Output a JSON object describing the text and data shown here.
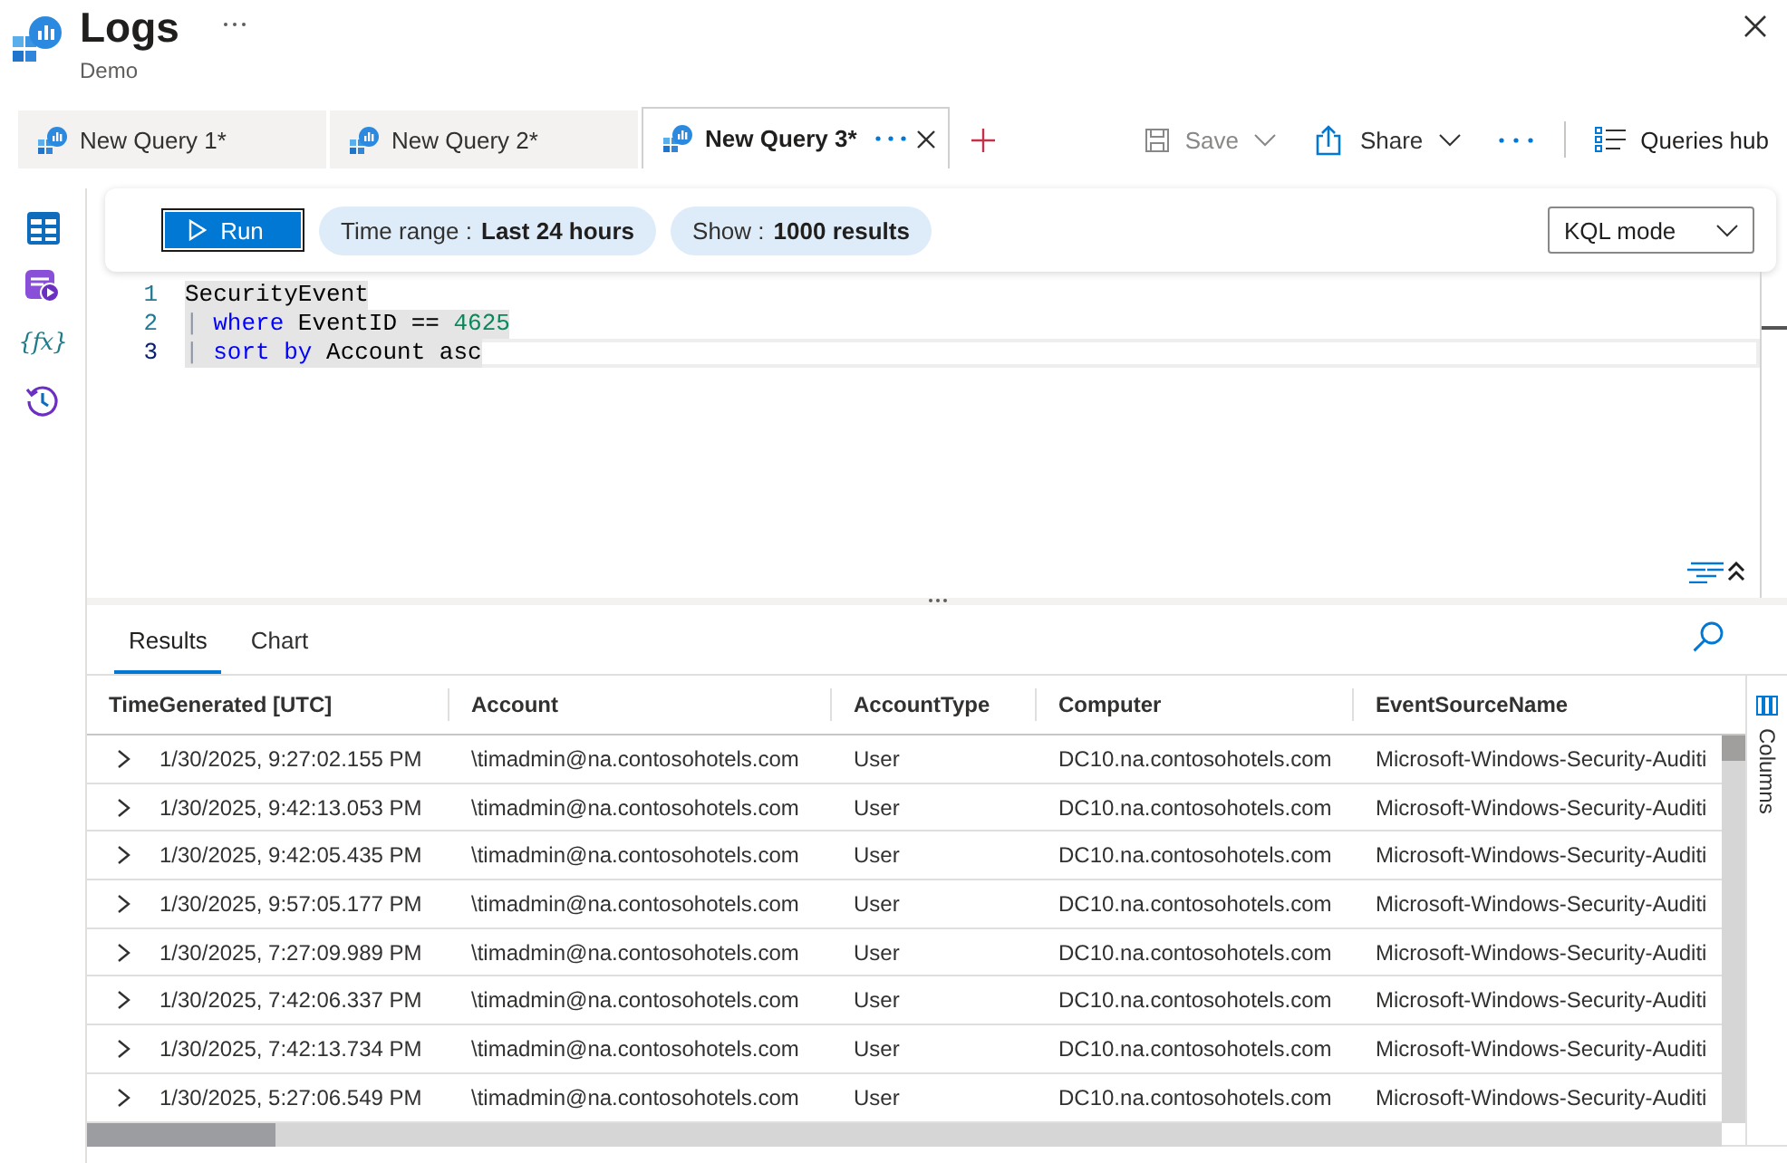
{
  "header": {
    "title": "Logs",
    "subtitle": "Demo"
  },
  "query_tabs": [
    {
      "label": "New Query 1*",
      "selected": false
    },
    {
      "label": "New Query 2*",
      "selected": false
    },
    {
      "label": "New Query 3*",
      "selected": true
    }
  ],
  "toolbar": {
    "save": {
      "label": "Save",
      "disabled": true
    },
    "share": {
      "label": "Share",
      "disabled": false
    },
    "queries_hub": {
      "label": "Queries hub"
    }
  },
  "left_rail": [
    {
      "kind": "tables"
    },
    {
      "kind": "queries"
    },
    {
      "kind": "functions",
      "glyph": "{fx}"
    },
    {
      "kind": "history"
    }
  ],
  "query_bar": {
    "run_label": "Run",
    "time_range": {
      "label": "Time range :",
      "value": "Last 24 hours"
    },
    "result_limit": {
      "label": "Show :",
      "value": "1000 results"
    },
    "mode": "KQL mode"
  },
  "editor": {
    "lines": [
      {
        "number": "1",
        "current": false,
        "selected": true,
        "tokens": [
          {
            "kind": "plain",
            "text": "SecurityEvent"
          }
        ]
      },
      {
        "number": "2",
        "current": false,
        "selected": true,
        "tokens": [
          {
            "kind": "operator",
            "text": "| "
          },
          {
            "kind": "keyword",
            "text": "where"
          },
          {
            "kind": "plain",
            "text": " EventID == "
          },
          {
            "kind": "number",
            "text": "4625"
          }
        ]
      },
      {
        "number": "3",
        "current": true,
        "selected": true,
        "tokens": [
          {
            "kind": "operator",
            "text": "| "
          },
          {
            "kind": "keyword",
            "text": "sort by"
          },
          {
            "kind": "plain",
            "text": " Account asc"
          }
        ]
      }
    ]
  },
  "results": {
    "tabs": [
      {
        "label": "Results",
        "selected": true
      },
      {
        "label": "Chart",
        "selected": false
      }
    ],
    "columns": [
      "TimeGenerated [UTC]",
      "Account",
      "AccountType",
      "Computer",
      "EventSourceName"
    ],
    "rows": [
      {
        "expanded": false,
        "cells": [
          "1/30/2025, 9:27:02.155 PM",
          "\\timadmin@na.contosohotels.com",
          "User",
          "DC10.na.contosohotels.com",
          "Microsoft-Windows-Security-Auditi"
        ]
      },
      {
        "expanded": false,
        "cells": [
          "1/30/2025, 9:42:13.053 PM",
          "\\timadmin@na.contosohotels.com",
          "User",
          "DC10.na.contosohotels.com",
          "Microsoft-Windows-Security-Auditi"
        ]
      },
      {
        "expanded": false,
        "cells": [
          "1/30/2025, 9:42:05.435 PM",
          "\\timadmin@na.contosohotels.com",
          "User",
          "DC10.na.contosohotels.com",
          "Microsoft-Windows-Security-Auditi"
        ]
      },
      {
        "expanded": false,
        "cells": [
          "1/30/2025, 9:57:05.177 PM",
          "\\timadmin@na.contosohotels.com",
          "User",
          "DC10.na.contosohotels.com",
          "Microsoft-Windows-Security-Auditi"
        ]
      },
      {
        "expanded": false,
        "cells": [
          "1/30/2025, 7:27:09.989 PM",
          "\\timadmin@na.contosohotels.com",
          "User",
          "DC10.na.contosohotels.com",
          "Microsoft-Windows-Security-Auditi"
        ]
      },
      {
        "expanded": false,
        "cells": [
          "1/30/2025, 7:42:06.337 PM",
          "\\timadmin@na.contosohotels.com",
          "User",
          "DC10.na.contosohotels.com",
          "Microsoft-Windows-Security-Auditi"
        ]
      },
      {
        "expanded": false,
        "cells": [
          "1/30/2025, 7:42:13.734 PM",
          "\\timadmin@na.contosohotels.com",
          "User",
          "DC10.na.contosohotels.com",
          "Microsoft-Windows-Security-Auditi"
        ]
      },
      {
        "expanded": false,
        "cells": [
          "1/30/2025, 5:27:06.549 PM",
          "\\timadmin@na.contosohotels.com",
          "User",
          "DC10.na.contosohotels.com",
          "Microsoft-Windows-Security-Auditi"
        ]
      }
    ],
    "side_panel": "Columns"
  }
}
